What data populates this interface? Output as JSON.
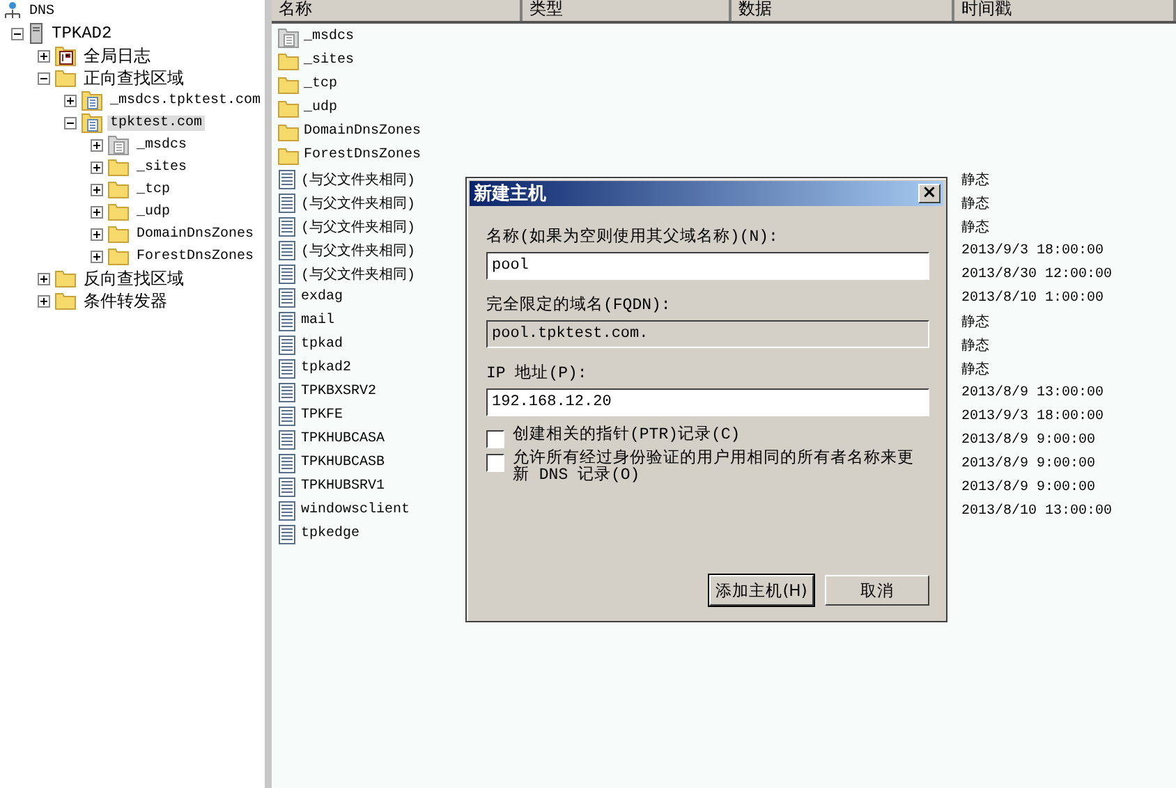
{
  "tree": {
    "root": {
      "label": "DNS"
    },
    "items": [
      {
        "label": "TPKAD2",
        "kind": "server",
        "expanded": true,
        "selected": false,
        "children": [
          {
            "label": "全局日志",
            "kind": "log",
            "expanded": false,
            "selected": false
          },
          {
            "label": "正向查找区域",
            "kind": "folder",
            "expanded": true,
            "selected": false,
            "children": [
              {
                "label": "_msdcs.tpktest.com",
                "kind": "zone",
                "expanded": false,
                "selected": false
              },
              {
                "label": "tpktest.com",
                "kind": "zone",
                "expanded": true,
                "selected": true,
                "children": [
                  {
                    "label": "_msdcs",
                    "kind": "zone-gray",
                    "expanded": false,
                    "selected": false
                  },
                  {
                    "label": "_sites",
                    "kind": "folder",
                    "expanded": false,
                    "selected": false
                  },
                  {
                    "label": "_tcp",
                    "kind": "folder",
                    "expanded": false,
                    "selected": false
                  },
                  {
                    "label": "_udp",
                    "kind": "folder",
                    "expanded": false,
                    "selected": false
                  },
                  {
                    "label": "DomainDnsZones",
                    "kind": "folder",
                    "expanded": false,
                    "selected": false
                  },
                  {
                    "label": "ForestDnsZones",
                    "kind": "folder",
                    "expanded": false,
                    "selected": false
                  }
                ]
              }
            ]
          },
          {
            "label": "反向查找区域",
            "kind": "folder",
            "expanded": false,
            "selected": false
          },
          {
            "label": "条件转发器",
            "kind": "folder",
            "expanded": false,
            "selected": false
          }
        ]
      }
    ]
  },
  "table": {
    "columns": [
      "名称",
      "类型",
      "数据",
      "时间戳"
    ],
    "rows": [
      {
        "kind": "zone-gray",
        "name": "_msdcs"
      },
      {
        "kind": "folder",
        "name": "_sites"
      },
      {
        "kind": "folder",
        "name": "_tcp"
      },
      {
        "kind": "folder",
        "name": "_udp"
      },
      {
        "kind": "folder",
        "name": "DomainDnsZones"
      },
      {
        "kind": "folder",
        "name": "ForestDnsZones"
      },
      {
        "kind": "record",
        "name": "(与父文件夹相同)",
        "timestamp": "静态"
      },
      {
        "kind": "record",
        "name": "(与父文件夹相同)",
        "timestamp": "静态"
      },
      {
        "kind": "record",
        "name": "(与父文件夹相同)",
        "timestamp": "静态"
      },
      {
        "kind": "record",
        "name": "(与父文件夹相同)",
        "timestamp": "2013/9/3 18:00:00"
      },
      {
        "kind": "record",
        "name": "(与父文件夹相同)",
        "timestamp": "2013/8/30 12:00:00"
      },
      {
        "kind": "record",
        "name": "exdag",
        "timestamp": "2013/8/10 1:00:00"
      },
      {
        "kind": "record",
        "name": "mail",
        "timestamp": "静态"
      },
      {
        "kind": "record",
        "name": "tpkad",
        "timestamp": "静态"
      },
      {
        "kind": "record",
        "name": "tpkad2",
        "timestamp": "静态"
      },
      {
        "kind": "record",
        "name": "TPKBXSRV2",
        "timestamp": "2013/8/9 13:00:00"
      },
      {
        "kind": "record",
        "name": "TPKFE",
        "timestamp": "2013/9/3 18:00:00"
      },
      {
        "kind": "record",
        "name": "TPKHUBCASA",
        "timestamp": "2013/8/9 9:00:00"
      },
      {
        "kind": "record",
        "name": "TPKHUBCASB",
        "timestamp": "2013/8/9 9:00:00"
      },
      {
        "kind": "record",
        "name": "TPKHUBSRV1",
        "timestamp": "2013/8/9 9:00:00"
      },
      {
        "kind": "record",
        "name": "windowsclient",
        "timestamp": "2013/8/10 13:00:00"
      },
      {
        "kind": "record",
        "name": "tpkedge"
      }
    ]
  },
  "dialog": {
    "title": "新建主机",
    "close": "×",
    "fields": [
      {
        "label": "名称(如果为空则使用其父域名称)(N):",
        "value": "pool",
        "disabled": false
      },
      {
        "label": "完全限定的域名(FQDN):",
        "value": "pool.tpktest.com.",
        "disabled": true
      },
      {
        "label": "IP 地址(P):",
        "value": "192.168.12.20",
        "disabled": false
      }
    ],
    "checkboxes": [
      {
        "label": "创建相关的指针(PTR)记录(C)",
        "checked": false
      },
      {
        "label": "允许所有经过身份验证的用户用相同的所有者名称来更新 DNS 记录(O)",
        "checked": false
      }
    ],
    "buttons": [
      {
        "label": "添加主机(H)",
        "default": true
      },
      {
        "label": "取消",
        "default": false
      }
    ]
  }
}
